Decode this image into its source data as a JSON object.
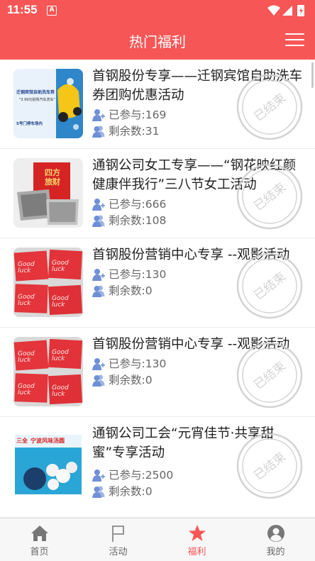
{
  "statusbar": {
    "time": "11:55",
    "app_badge": "A"
  },
  "header": {
    "title": "热门福利",
    "menu_icon": "hamburger-menu-icon"
  },
  "labels": {
    "joined": "已参与:",
    "remaining": "剩余数:",
    "ended_stamp": "已结束"
  },
  "thumb_texts": {
    "item1_line1": "迁钢宾馆自助洗车券",
    "item1_line2": "\"3.99元抢购汽车洗车\"",
    "item1_line3": "5号门停车场内",
    "item2_box": "四方旅财",
    "item3_card": "Good luck",
    "item5_brand": "三全",
    "item5_product": "宁波风味汤圆"
  },
  "items": [
    {
      "title": "首钢股份专享——迁钢宾馆自助洗车券团购优惠活动",
      "joined": "169",
      "remaining": "31",
      "status": "已结束"
    },
    {
      "title": "通钢公司女工专享——“钢花映红颜健康伴我行”三八节女工活动",
      "joined": "666",
      "remaining": "108",
      "status": "已结束"
    },
    {
      "title": "首钢股份营销中心专享 --观影活动",
      "joined": "130",
      "remaining": "0",
      "status": "已结束"
    },
    {
      "title": "首钢股份营销中心专享 --观影活动",
      "joined": "130",
      "remaining": "0",
      "status": "已结束"
    },
    {
      "title": "通钢公司工会“元宵佳节·共享甜蜜”专享活动",
      "joined": "2500",
      "remaining": "0",
      "status": "已结束"
    }
  ],
  "tabs": [
    {
      "label": "首页",
      "icon": "home-icon",
      "active": false
    },
    {
      "label": "活动",
      "icon": "flag-icon",
      "active": false
    },
    {
      "label": "福利",
      "icon": "star-icon",
      "active": true
    },
    {
      "label": "我的",
      "icon": "user-icon",
      "active": false
    }
  ],
  "colors": {
    "primary": "#f75656",
    "icon_blue": "#6f8fd6",
    "stamp_gray": "#cfcfcf",
    "tab_inactive": "#666666"
  }
}
